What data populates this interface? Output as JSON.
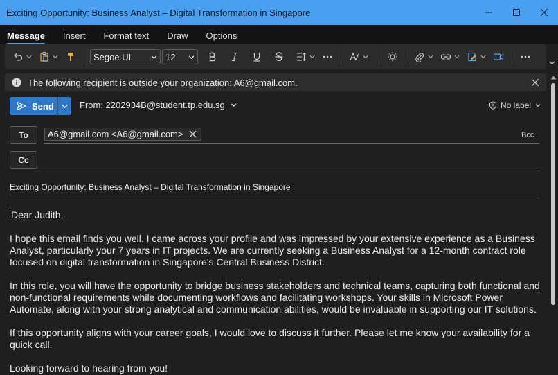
{
  "window": {
    "title": "Exciting Opportunity: Business Analyst – Digital Transformation in Singapore"
  },
  "tabs": [
    {
      "label": "Message",
      "active": true
    },
    {
      "label": "Insert",
      "active": false
    },
    {
      "label": "Format text",
      "active": false
    },
    {
      "label": "Draw",
      "active": false
    },
    {
      "label": "Options",
      "active": false
    }
  ],
  "ribbon": {
    "font_name": "Segoe UI",
    "font_size": "12",
    "icons": [
      "undo-icon",
      "paste-icon",
      "format-painter-icon",
      "bold-icon",
      "italic-icon",
      "underline-icon",
      "strikethrough-icon",
      "paragraph-spacing-icon",
      "more-icon",
      "styles-icon",
      "editor-icon",
      "attach-icon",
      "link-icon",
      "sensitivity-icon",
      "meeting-icon",
      "overflow-icon"
    ]
  },
  "infobar": {
    "message": "The following recipient is outside your organization: A6@gmail.com."
  },
  "compose": {
    "send_label": "Send",
    "from_label": "From: 2202934B@student.tp.edu.sg",
    "sensitivity_label": "No label",
    "to_label": "To",
    "cc_label": "Cc",
    "bcc_label": "Bcc",
    "to_recipient": "A6@gmail.com <A6@gmail.com>",
    "subject": "Exciting Opportunity: Business Analyst – Digital Transformation in Singapore"
  },
  "body": {
    "greeting": "Dear Judith,",
    "p1": "I hope this email finds you well. I came across your profile and was impressed by your extensive experience as a Business Analyst, particularly your 7 years in IT projects. We are currently seeking a Business Analyst for a 12-month contract role focused on digital transformation in Singapore's Central Business District.",
    "p2": "In this role, you will have the opportunity to bridge business stakeholders and technical teams, capturing both functional and non-functional requirements while documenting workflows and facilitating workshops. Your skills in Microsoft Power Automate, along with your strong analytical and communication abilities, would be invaluable in supporting our IT solutions.",
    "p3": "If this opportunity aligns with your career goals, I would love to discuss it further. Please let me know your availability for a quick call.",
    "p4": "Looking forward to hearing from you!"
  },
  "colors": {
    "titlebar": "#4aa0f0",
    "accent": "#2f78c8",
    "background": "#1f1f1f",
    "ribbon": "#2b2b2b"
  }
}
